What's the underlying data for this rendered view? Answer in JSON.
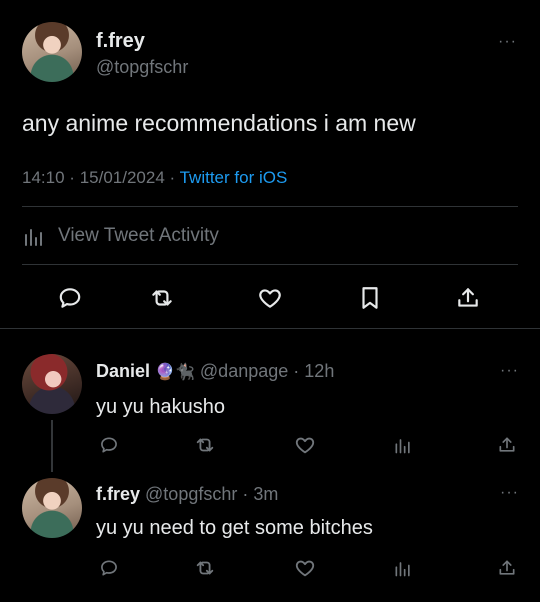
{
  "main_tweet": {
    "author_name": "f.frey",
    "author_handle": "@topgfschr",
    "text": "any anime recommendations i am new",
    "time": "14:10",
    "separator1": "·",
    "date": "15/01/2024",
    "separator2": "·",
    "source": "Twitter for iOS",
    "activity_label": "View Tweet Activity"
  },
  "replies": [
    {
      "author_name": "Daniel",
      "emoji": "🔮🐈‍⬛",
      "author_handle": "@danpage",
      "separator": "·",
      "age": "12h",
      "text": "yu yu hakusho"
    },
    {
      "author_name": "f.frey",
      "author_handle": "@topgfschr",
      "separator": "·",
      "age": "3m",
      "text": "yu yu need to get some bitches"
    }
  ],
  "more_label": "···",
  "colors": {
    "background": "#000000",
    "text": "#e7e9ea",
    "muted": "#71767b",
    "accent": "#1d9bf0",
    "divider": "#2f3336"
  }
}
